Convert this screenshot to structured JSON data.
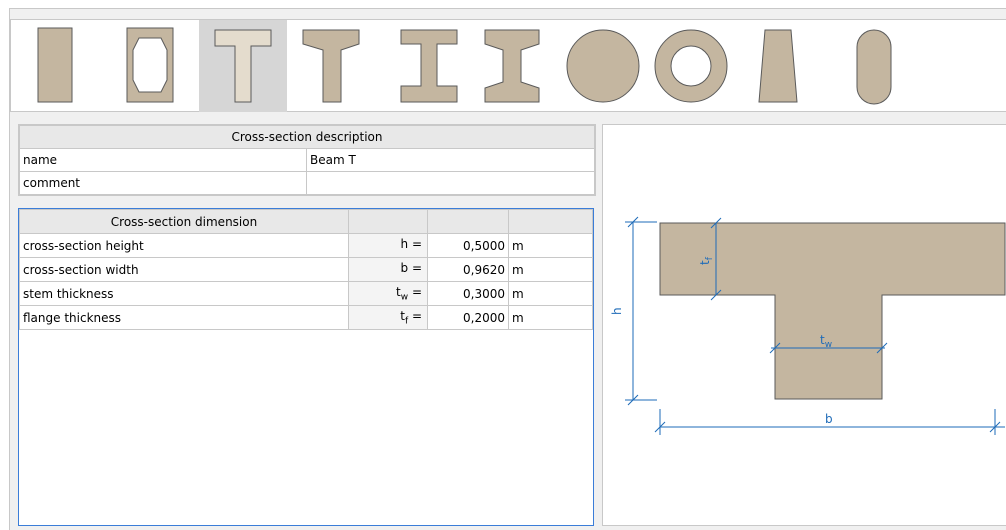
{
  "toolbar": {
    "shapes": [
      {
        "id": "rectangle",
        "icon": "rectangle-section-icon",
        "active": false
      },
      {
        "id": "hollow-octagon",
        "icon": "hollow-section-icon",
        "active": false
      },
      {
        "id": "t-beam",
        "icon": "t-section-icon",
        "active": true
      },
      {
        "id": "t-beam-haunched",
        "icon": "t-haunch-section-icon",
        "active": false
      },
      {
        "id": "i-beam",
        "icon": "i-section-icon",
        "active": false
      },
      {
        "id": "i-beam-haunched",
        "icon": "i-haunch-section-icon",
        "active": false
      },
      {
        "id": "circle",
        "icon": "circle-section-icon",
        "active": false
      },
      {
        "id": "ring",
        "icon": "ring-section-icon",
        "active": false
      },
      {
        "id": "trapezoid",
        "icon": "trapezoid-section-icon",
        "active": false
      },
      {
        "id": "oval",
        "icon": "oval-section-icon",
        "active": false
      }
    ]
  },
  "description": {
    "header": "Cross-section description",
    "rows": [
      {
        "label": "name",
        "value": "Beam T"
      },
      {
        "label": "comment",
        "value": ""
      }
    ]
  },
  "dimensions": {
    "header": "Cross-section dimension",
    "rows": [
      {
        "label": "cross-section height",
        "sym": "h",
        "sub": "",
        "eq": " =",
        "value": "0,5000",
        "unit": "m"
      },
      {
        "label": "cross-section width",
        "sym": "b",
        "sub": "",
        "eq": " =",
        "value": "0,9620",
        "unit": "m"
      },
      {
        "label": "stem thickness",
        "sym": "t",
        "sub": "w",
        "eq": " =",
        "value": "0,3000",
        "unit": "m"
      },
      {
        "label": "flange thickness",
        "sym": "t",
        "sub": "f",
        "eq": " =",
        "value": "0,2000",
        "unit": "m"
      }
    ]
  },
  "preview": {
    "labels": {
      "h": "h",
      "b": "b",
      "tw_base": "t",
      "tw_sub": "w",
      "tf_base": "t",
      "tf_sub": "f"
    }
  },
  "colors": {
    "shape_fill": "#c4b6a0",
    "shape_stroke": "#5a5a5a",
    "dim_line": "#1e6bb8",
    "focus_border": "#3b7dd8"
  }
}
